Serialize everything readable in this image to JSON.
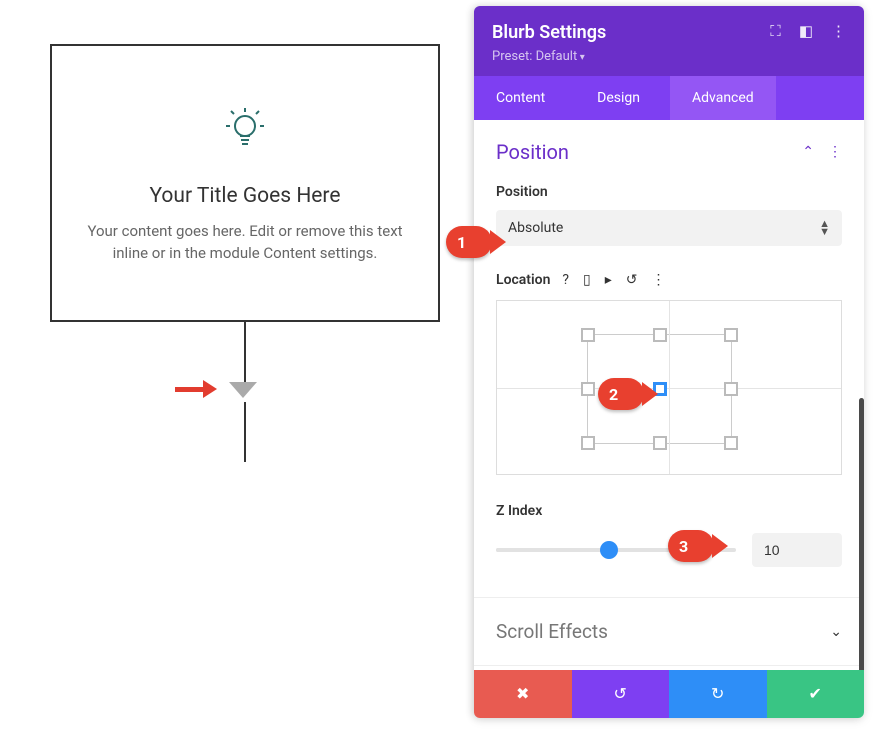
{
  "preview": {
    "title": "Your Title Goes Here",
    "desc": "Your content goes here. Edit or remove this text inline or in the module Content settings."
  },
  "panel": {
    "title": "Blurb Settings",
    "preset": "Preset: Default",
    "tabs": [
      "Content",
      "Design",
      "Advanced"
    ],
    "active_tab": 2
  },
  "position": {
    "group_title": "Position",
    "select_label": "Position",
    "select_value": "Absolute",
    "location_label": "Location",
    "zindex_label": "Z Index",
    "zindex_value": "10"
  },
  "scroll_effects": {
    "title": "Scroll Effects"
  },
  "callouts": {
    "one": "1",
    "two": "2",
    "three": "3"
  }
}
